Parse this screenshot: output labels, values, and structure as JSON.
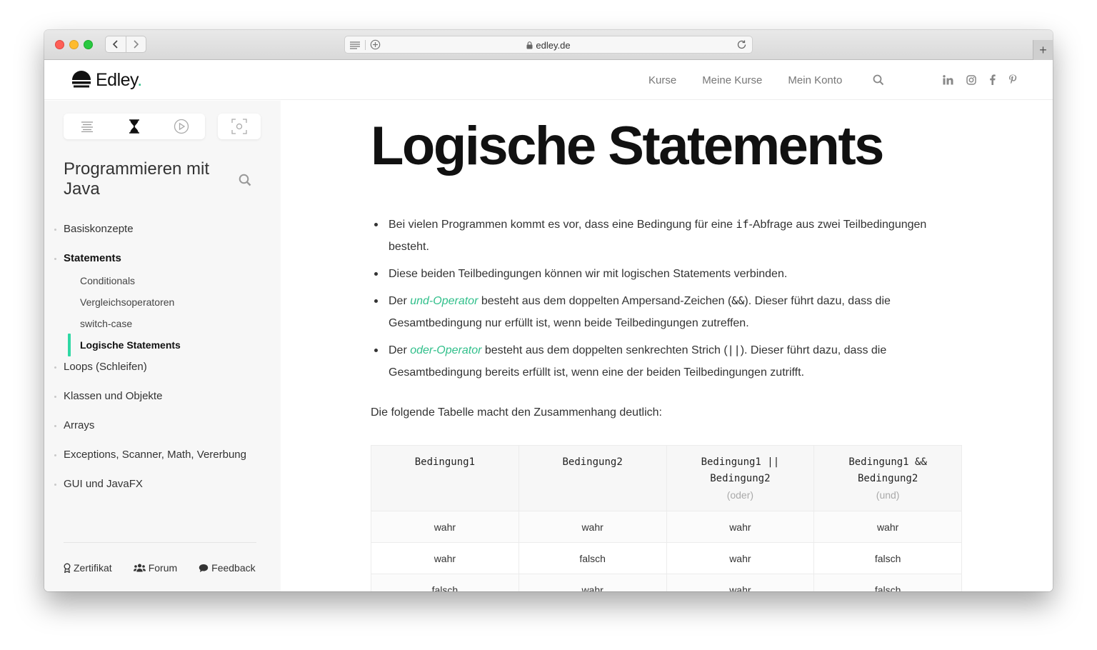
{
  "browser": {
    "url": "edley.de",
    "newtab_label": "+"
  },
  "site": {
    "logo_text": "Edley",
    "logo_dot": ".",
    "nav": [
      "Kurse",
      "Meine Kurse",
      "Mein Konto"
    ],
    "socials": [
      "linkedin-icon",
      "instagram-icon",
      "facebook-icon",
      "pinterest-icon"
    ]
  },
  "sidebar": {
    "course_title": "Programmieren mit Java",
    "menu": [
      {
        "label": "Basiskonzepte"
      },
      {
        "label": "Statements",
        "active": true
      },
      {
        "label": "Loops (Schleifen)"
      },
      {
        "label": "Klassen und Objekte"
      },
      {
        "label": "Arrays"
      },
      {
        "label": "Exceptions, Scanner, Math, Vererbung"
      },
      {
        "label": "GUI und JavaFX"
      }
    ],
    "submenu": [
      "Conditionals",
      "Vergleichsoperatoren",
      "switch-case",
      "Logische Statements"
    ],
    "footer": {
      "certificate": "Zertifikat",
      "forum": "Forum",
      "feedback": "Feedback"
    }
  },
  "main": {
    "title": "Logische Statements",
    "bullet1": {
      "pre": "Bei vielen Programmen kommt es vor, dass eine Bedingung für eine ",
      "code": "if",
      "post": "-Abfrage aus zwei Teilbedingungen besteht."
    },
    "bullet2": "Diese beiden Teilbedingungen können wir mit logischen Statements verbinden.",
    "bullet3": {
      "pre": "Der ",
      "link": "und-Operator",
      "mid": " besteht aus dem doppelten Ampersand-Zeichen (",
      "code": "&&",
      "post": "). Dieser führt dazu, dass die Gesamtbedingung nur erfüllt ist, wenn beide Teilbedingungen zutreffen."
    },
    "bullet4": {
      "pre": "Der ",
      "link": "oder-Operator",
      "mid": " besteht aus dem doppelten senkrechten Strich (",
      "code": "||",
      "post": "). Dieser führt dazu, dass die Gesamtbedingung bereits erfüllt ist, wenn eine der beiden Teilbedingungen zutrifft."
    },
    "intro": "Die folgende Tabelle macht den Zusammenhang deutlich:",
    "table": {
      "headers": [
        {
          "line1": "Bedingung1",
          "line2": "",
          "sub": ""
        },
        {
          "line1": "Bedingung2",
          "line2": "",
          "sub": ""
        },
        {
          "line1": "Bedingung1 ||",
          "line2": "Bedingung2",
          "sub": "(oder)"
        },
        {
          "line1": "Bedingung1 &&",
          "line2": "Bedingung2",
          "sub": "(und)"
        }
      ],
      "rows": [
        [
          "wahr",
          "wahr",
          "wahr",
          "wahr"
        ],
        [
          "wahr",
          "falsch",
          "wahr",
          "falsch"
        ],
        [
          "falsch",
          "wahr",
          "wahr",
          "falsch"
        ]
      ]
    }
  },
  "colors": {
    "accent": "#2fbf8a",
    "active_marker": "#2fd8a4"
  }
}
